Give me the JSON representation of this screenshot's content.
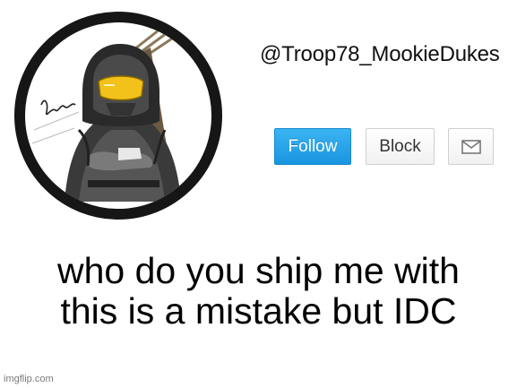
{
  "profile": {
    "username": "@Troop78_MookieDukes",
    "avatar_icon": "armored-soldier-avatar",
    "avatar_signature": "Mer"
  },
  "actions": {
    "follow_label": "Follow",
    "block_label": "Block",
    "message_icon": "envelope-icon"
  },
  "caption": {
    "line1": "who do you ship me with",
    "line2": "this is a mistake but IDC"
  },
  "watermark": "imgflip.com",
  "colors": {
    "follow_bg": "#1da1f2",
    "ring": "#161616",
    "visor": "#f2c21b"
  }
}
